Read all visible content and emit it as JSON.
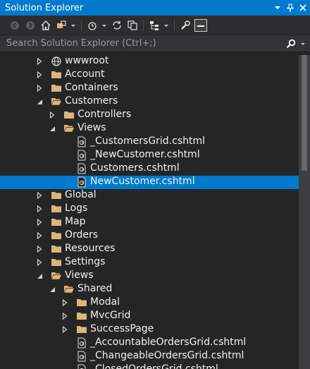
{
  "panel": {
    "title": "Solution Explorer"
  },
  "toolbar": {
    "buttons": [
      {
        "icon": "back-arrow-icon"
      },
      {
        "icon": "forward-arrow-icon"
      },
      {
        "icon": "home-icon"
      },
      {
        "icon": "switch-views-icon"
      },
      {
        "icon": "history-icon"
      },
      {
        "icon": "sync-icon"
      },
      {
        "icon": "copy-icon"
      },
      {
        "icon": "tree-view-icon"
      },
      {
        "icon": "wrench-icon"
      },
      {
        "icon": "collapse-all-icon"
      }
    ]
  },
  "search": {
    "placeholder": "Search Solution Explorer (Ctrl+;)"
  },
  "tree": {
    "items": [
      {
        "label": "wwwroot",
        "level": 0,
        "expander": "collapsed",
        "icon": "globe-icon"
      },
      {
        "label": "Account",
        "level": 0,
        "expander": "collapsed",
        "icon": "folder-icon"
      },
      {
        "label": "Containers",
        "level": 0,
        "expander": "collapsed",
        "icon": "folder-icon"
      },
      {
        "label": "Customers",
        "level": 0,
        "expander": "expanded",
        "icon": "folder-open-icon"
      },
      {
        "label": "Controllers",
        "level": 1,
        "expander": "collapsed",
        "icon": "folder-icon"
      },
      {
        "label": "Views",
        "level": 1,
        "expander": "expanded",
        "icon": "folder-open-icon"
      },
      {
        "label": "_CustomersGrid.cshtml",
        "level": 2,
        "expander": "none",
        "icon": "cshtml-file-icon"
      },
      {
        "label": "_NewCustomer.cshtml",
        "level": 2,
        "expander": "none",
        "icon": "cshtml-file-icon"
      },
      {
        "label": "Customers.cshtml",
        "level": 2,
        "expander": "none",
        "icon": "cshtml-file-icon"
      },
      {
        "label": "NewCustomer.cshtml",
        "level": 2,
        "expander": "none",
        "icon": "cshtml-file-icon",
        "selected": true,
        "checked": true
      },
      {
        "label": "Global",
        "level": 0,
        "expander": "collapsed",
        "icon": "folder-icon"
      },
      {
        "label": "Logs",
        "level": 0,
        "expander": "collapsed",
        "icon": "folder-icon"
      },
      {
        "label": "Map",
        "level": 0,
        "expander": "collapsed",
        "icon": "folder-icon"
      },
      {
        "label": "Orders",
        "level": 0,
        "expander": "collapsed",
        "icon": "folder-icon"
      },
      {
        "label": "Resources",
        "level": 0,
        "expander": "collapsed",
        "icon": "folder-icon"
      },
      {
        "label": "Settings",
        "level": 0,
        "expander": "collapsed",
        "icon": "folder-icon"
      },
      {
        "label": "Views",
        "level": 0,
        "expander": "expanded",
        "icon": "folder-open-icon"
      },
      {
        "label": "Shared",
        "level": 1,
        "expander": "expanded",
        "icon": "folder-open-icon"
      },
      {
        "label": "Modal",
        "level": 2,
        "expander": "collapsed",
        "icon": "folder-icon"
      },
      {
        "label": "MvcGrid",
        "level": 2,
        "expander": "collapsed",
        "icon": "folder-icon"
      },
      {
        "label": "SuccessPage",
        "level": 2,
        "expander": "collapsed",
        "icon": "folder-icon"
      },
      {
        "label": "_AccountableOrdersGrid.cshtml",
        "level": 2,
        "expander": "none",
        "icon": "cshtml-file-icon"
      },
      {
        "label": "_ChangeableOrdersGrid.cshtml",
        "level": 2,
        "expander": "none",
        "icon": "cshtml-file-icon"
      },
      {
        "label": "_ClosedOrdersGrid.cshtml",
        "level": 2,
        "expander": "none",
        "icon": "cshtml-file-icon"
      }
    ]
  },
  "colors": {
    "accent": "#007acc",
    "folder": "#dcb67a",
    "background": "#252526",
    "check": "#e51400"
  }
}
